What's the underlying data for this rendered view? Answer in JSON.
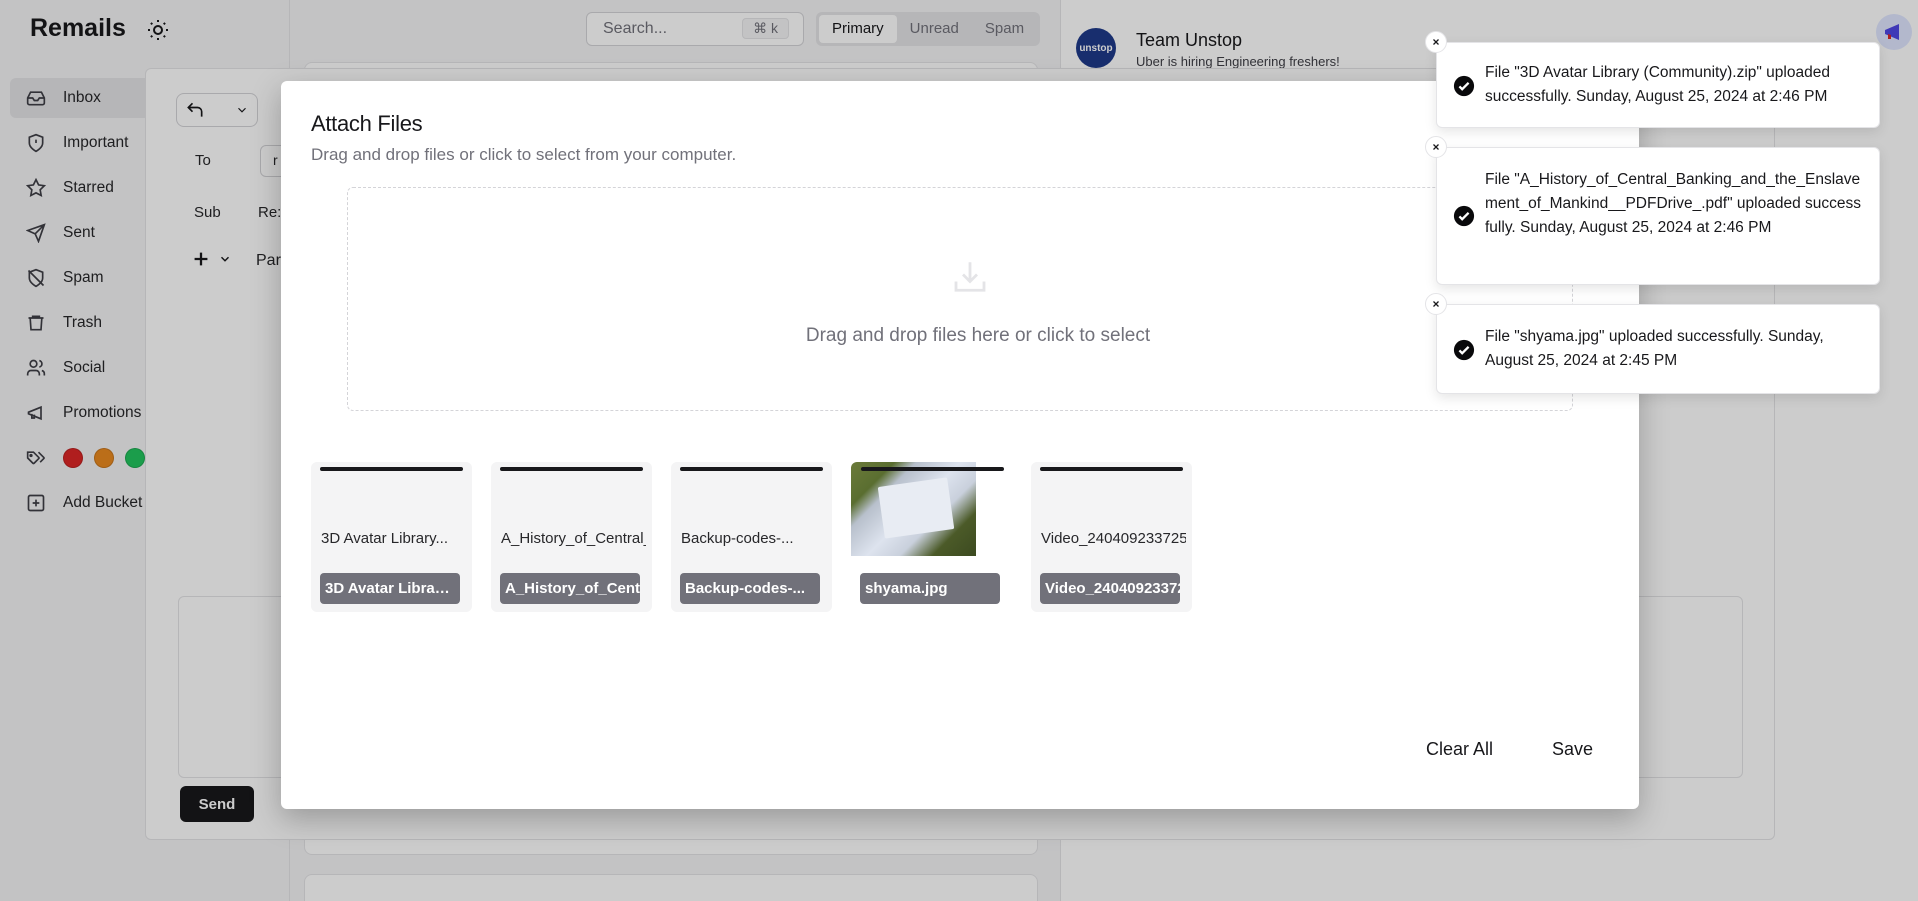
{
  "app": {
    "title": "Remails"
  },
  "sidebar": {
    "items": [
      {
        "label": "Inbox",
        "icon": "inbox-icon"
      },
      {
        "label": "Important",
        "icon": "shield-icon"
      },
      {
        "label": "Starred",
        "icon": "star-icon"
      },
      {
        "label": "Sent",
        "icon": "send-icon"
      },
      {
        "label": "Spam",
        "icon": "spam-shield-icon"
      },
      {
        "label": "Trash",
        "icon": "trash-icon"
      },
      {
        "label": "Social",
        "icon": "users-icon"
      },
      {
        "label": "Promotions",
        "icon": "megaphone-icon"
      }
    ],
    "tag_colors": [
      "#dc2626",
      "#ea8a20",
      "#22c55e"
    ],
    "add_bucket_label": "Add Bucket"
  },
  "search": {
    "placeholder": "Search...",
    "shortcut": "⌘ k"
  },
  "mail_tabs": [
    "Primary",
    "Unread",
    "Spam"
  ],
  "reader": {
    "from": "Team Unstop",
    "subject": "Uber is hiring Engineering freshers!",
    "logo_text": "unstop"
  },
  "compose": {
    "to_label": "To",
    "to_value": "r",
    "subject_label": "Sub",
    "subject_value": "Re:",
    "toolbar_text": "Par",
    "send_label": "Send"
  },
  "attach_modal": {
    "title": "Attach Files",
    "description": "Drag and drop files or click to select from your computer.",
    "dropzone_text": "Drag and drop files here or click to select",
    "files": [
      {
        "name": "3D Avatar Library...",
        "label": "3D Avatar Library..."
      },
      {
        "name": "A_History_of_Central_",
        "label": "A_History_of_Central_"
      },
      {
        "name": "Backup-codes-...",
        "label": "Backup-codes-..."
      },
      {
        "name": "",
        "label": "shyama.jpg"
      },
      {
        "name": "Video_240409233725",
        "label": "Video_240409233725"
      }
    ],
    "clear_label": "Clear All",
    "save_label": "Save"
  },
  "toasts": [
    {
      "message": "File \"3D Avatar Library (Community).zip\" uploaded successfully. Sunday, August 25, 2024 at 2:46 PM"
    },
    {
      "message": "File \"A_History_of_Central_Banking_and_the_Enslavement_of_Mankind__PDFDrive_.pdf\" uploaded successfully. Sunday, August 25, 2024 at 2:46 PM"
    },
    {
      "message": "File \"shyama.jpg\" uploaded successfully. Sunday, August 25, 2024 at 2:45 PM"
    }
  ]
}
